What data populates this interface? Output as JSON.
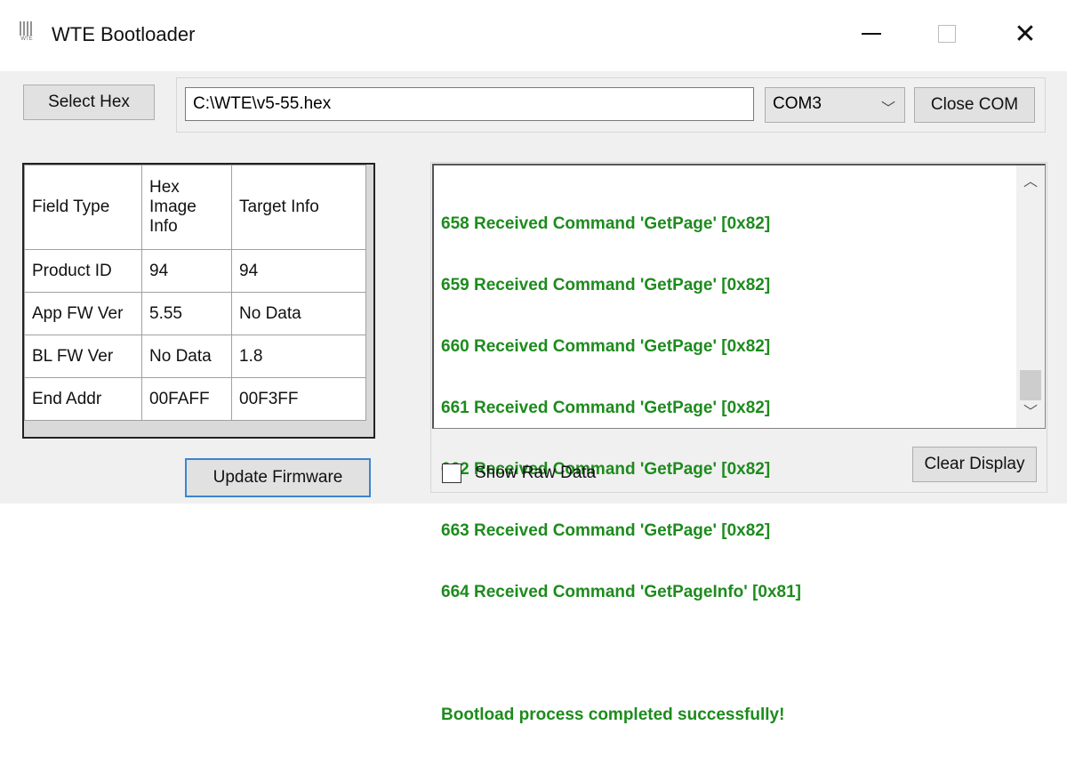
{
  "window": {
    "title": "WTE Bootloader",
    "icon_label": "WTE"
  },
  "toolbar": {
    "select_hex_label": "Select Hex",
    "hex_path_value": "C:\\WTE\\v5-55.hex",
    "com_port_selected": "COM3",
    "close_com_label": "Close COM"
  },
  "info_table": {
    "headers": [
      "Field Type",
      "Hex Image Info",
      "Target Info"
    ],
    "rows": [
      [
        "Product ID",
        "94",
        "94"
      ],
      [
        "App FW Ver",
        "5.55",
        "No Data"
      ],
      [
        "BL FW Ver",
        "No Data",
        "1.8"
      ],
      [
        "End Addr",
        "00FAFF",
        "00F3FF"
      ]
    ]
  },
  "update_button_label": "Update Firmware",
  "log": {
    "lines": [
      "658 Received Command 'GetPage' [0x82]",
      "659 Received Command 'GetPage' [0x82]",
      "660 Received Command 'GetPage' [0x82]",
      "661 Received Command 'GetPage' [0x82]",
      "662 Received Command 'GetPage' [0x82]",
      "663 Received Command 'GetPage' [0x82]",
      "664 Received Command 'GetPageInfo' [0x81]",
      "",
      "Bootload process completed successfully!"
    ],
    "text_color": "#1d8b1d"
  },
  "show_raw_data_label": "Show Raw Data",
  "show_raw_data_checked": false,
  "clear_display_label": "Clear Display",
  "icons": {
    "minimize": "minimize-icon",
    "maximize": "maximize-icon",
    "close": "close-icon",
    "combo_arrow": "chevron-down-icon",
    "scroll_up": "chevron-up-icon",
    "scroll_down": "chevron-down-icon"
  }
}
